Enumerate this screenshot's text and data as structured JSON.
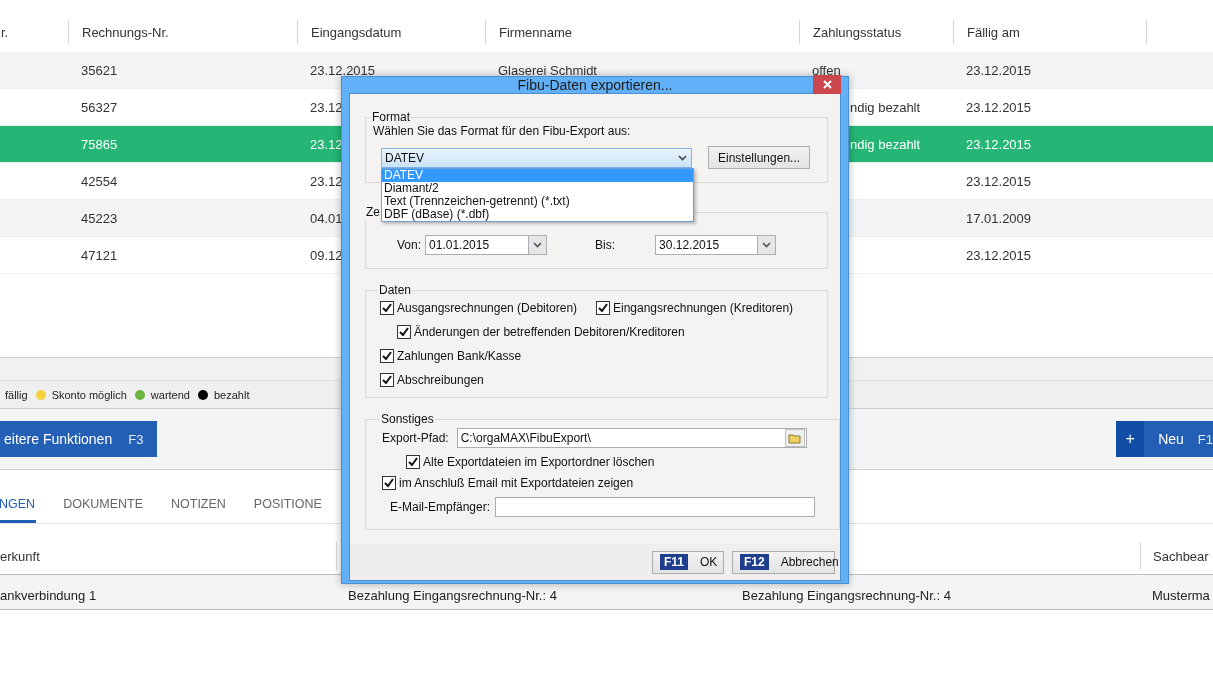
{
  "table": {
    "columns": [
      "r.",
      "Rechnungs-Nr.",
      "Eingangsdatum",
      "Firmenname",
      "Zahlungsstatus",
      "Fällig am"
    ],
    "rows": [
      {
        "selected": false,
        "cells": {
          "rechnungs_nr": "35621",
          "eingangsdatum": "23.12.2015",
          "firmenname": "Glaserei Schmidt",
          "zahlungsstatus": "offen",
          "faellig_am": "23.12.2015"
        }
      },
      {
        "selected": false,
        "cells": {
          "rechnungs_nr": "56327",
          "eingangsdatum": "23.12",
          "zahlungsstatus": "ndig bezahlt",
          "faellig_am": "23.12.2015"
        }
      },
      {
        "selected": true,
        "cells": {
          "rechnungs_nr": "75865",
          "eingangsdatum": "23.12",
          "zahlungsstatus": "ndig bezahlt",
          "faellig_am": "23.12.2015"
        }
      },
      {
        "selected": false,
        "cells": {
          "rechnungs_nr": "42554",
          "eingangsdatum": "23.12",
          "faellig_am": "23.12.2015"
        }
      },
      {
        "selected": false,
        "cells": {
          "rechnungs_nr": "45223",
          "eingangsdatum": "04.01",
          "faellig_am": "17.01.2009"
        }
      },
      {
        "selected": false,
        "cells": {
          "rechnungs_nr": "47121",
          "eingangsdatum": "09.12",
          "faellig_am": "23.12.2015"
        }
      }
    ]
  },
  "legend": [
    {
      "label": "fällig"
    },
    {
      "label": "Skonto möglich",
      "color": "#f5d33c"
    },
    {
      "label": "wartend",
      "color": "#6cb43f"
    },
    {
      "label": "bezahlt",
      "color": "#000000"
    }
  ],
  "toolbar": {
    "more_button": {
      "label": "eitere Funktionen",
      "shortcut": "F3"
    },
    "new_button": {
      "icon_text": "+",
      "label": "Neu",
      "shortcut": "F1"
    }
  },
  "tabs": [
    {
      "label": "NGEN",
      "selected": true
    },
    {
      "label": "DOKUMENTE",
      "selected": false
    },
    {
      "label": "NOTIZEN",
      "selected": false
    },
    {
      "label": "POSITIONE",
      "selected": false
    }
  ],
  "detail_table": {
    "columns": {
      "herkunft": "erkunft",
      "sachbearbeiter": "Sachbear"
    },
    "rows": [
      {
        "herkunft": "ankverbindung 1",
        "column_2": "Bezahlung Eingangsrechnung-Nr.: 4",
        "column_3": "Bezahlung Eingangsrechnung-Nr.: 4",
        "sachbearbeiter": "Musterma"
      }
    ]
  },
  "dialog": {
    "title": "Fibu-Daten exportieren...",
    "format_group": {
      "title": "Format",
      "prompt": "Wählen Sie das Format für den Fibu-Export aus:",
      "format": {
        "value": "DATEV",
        "expanded": true,
        "options": [
          {
            "label": "DATEV",
            "selected": true
          },
          {
            "label": "Diamant/2",
            "selected": false
          },
          {
            "label": "Text (Trennzeichen-getrennt) (*.txt)",
            "selected": false
          },
          {
            "label": "DBF (dBase) (*.dbf)",
            "selected": false
          }
        ]
      },
      "settings_button": "Einstellungen..."
    },
    "period_group": {
      "title": "Ze",
      "from_label": "Von:",
      "from": "01.01.2015",
      "to_label": "Bis:",
      "to": "30.12.2015"
    },
    "data_group": {
      "title": "Daten",
      "rows": [
        {
          "indented": false,
          "items": [
            {
              "label": "Ausgangsrechnungen (Debitoren)",
              "checked": true
            },
            {
              "label": "Eingangsrechnungen (Kreditoren)",
              "checked": true
            }
          ]
        },
        {
          "indented": true,
          "items": [
            {
              "label": "Änderungen der betreffenden Debitoren/Kreditoren",
              "checked": true
            }
          ]
        },
        {
          "indented": false,
          "items": [
            {
              "label": "Zahlungen Bank/Kasse",
              "checked": true
            }
          ]
        },
        {
          "indented": false,
          "items": [
            {
              "label": "Abschreibungen",
              "checked": true
            }
          ]
        }
      ]
    },
    "other_group": {
      "title": "Sonstiges",
      "path_label": "Export-Pfad:",
      "path": "C:\\orgaMAX\\FibuExport\\",
      "options": [
        {
          "label": "Alte Exportdateien im Exportordner löschen",
          "checked": true,
          "indented": true
        },
        {
          "label": "im Anschluß Email mit Exportdateien zeigen",
          "checked": true,
          "indented": false
        }
      ],
      "email_label": "E-Mail-Empfänger:"
    },
    "buttons": [
      {
        "key": "F11",
        "label": "OK"
      },
      {
        "key": "F12",
        "label": "Abbrechen"
      }
    ]
  }
}
